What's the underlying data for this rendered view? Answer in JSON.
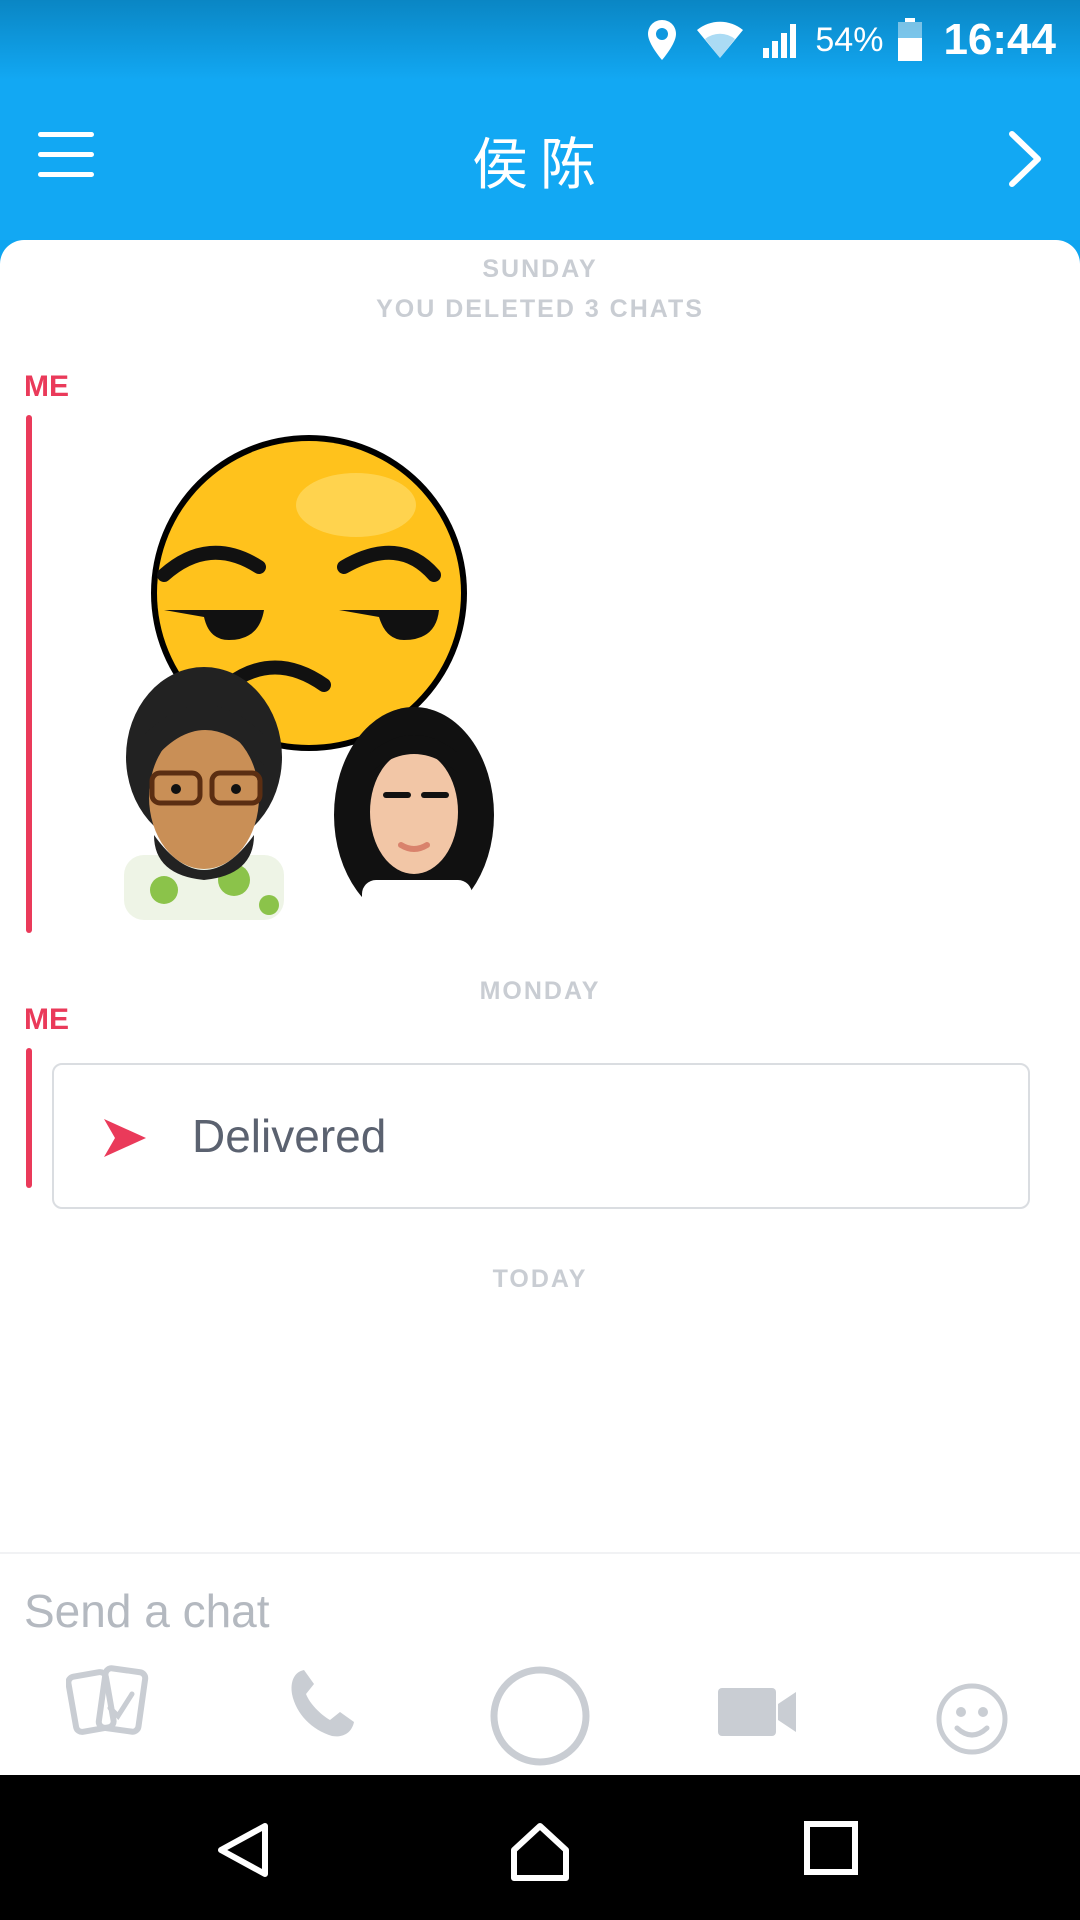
{
  "status_bar": {
    "battery_percent": "54%",
    "time": "16:44",
    "icons": [
      "location-icon",
      "wifi-icon",
      "signal-icon",
      "battery-icon"
    ]
  },
  "header": {
    "title": "侯陈",
    "menu_icon": "hamburger-menu-icon",
    "forward_icon": "chevron-right-icon"
  },
  "chat": {
    "sunday_label": "SUNDAY",
    "deleted_notice": "YOU DELETED 3 CHATS",
    "first_sender": "ME",
    "bitmoji_sticker": "bitmoji-sticker",
    "monday_label": "MONDAY",
    "second_sender": "ME",
    "delivered_text": "Delivered",
    "today_label": "TODAY"
  },
  "composer": {
    "placeholder": "Send a chat",
    "tools": [
      "memories-icon",
      "phone-icon",
      "capture-button",
      "video-icon",
      "emoji-icon"
    ]
  },
  "nav": {
    "buttons": [
      "back-icon",
      "home-icon",
      "recents-icon"
    ]
  },
  "colors": {
    "brand_blue": "#12a8f3",
    "me_red": "#ea3a5a",
    "muted_gray": "#c9cdd3"
  }
}
